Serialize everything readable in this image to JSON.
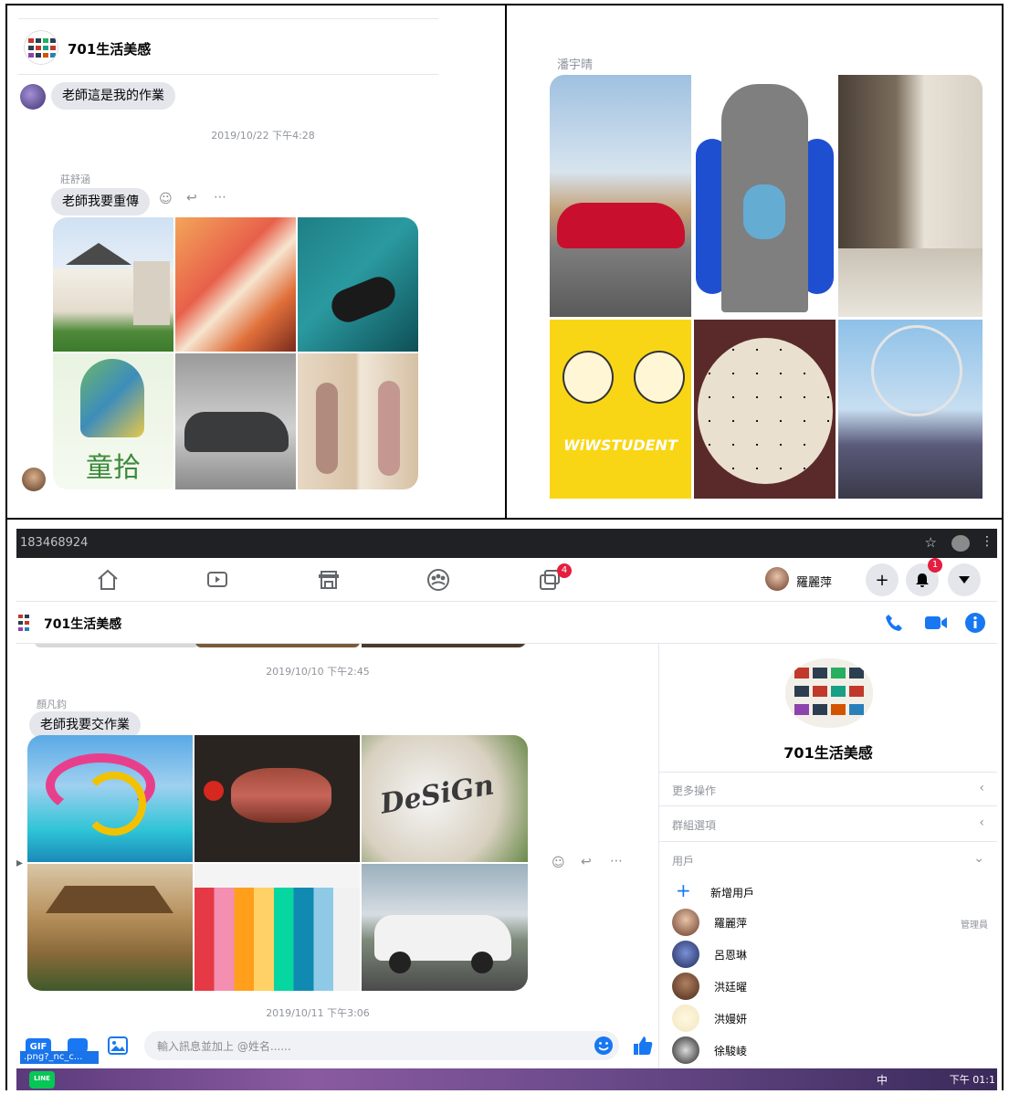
{
  "panel_top_left": {
    "group_title": "701生活美感",
    "message_1": "老師這是我的作業",
    "timestamp": "2019/10/22 下午4:28",
    "sender_name": "莊舒涵",
    "message_2": "老師我要重傳",
    "photo_labels": {
      "poster_text": "童拾"
    }
  },
  "panel_top_right": {
    "sender_name": "潘宇晴",
    "photo_labels": {
      "cartoon_text": "WiWSTUDENT"
    }
  },
  "browser": {
    "url_text": "183468924"
  },
  "facebook_nav": {
    "profile_name": "羅麗萍",
    "group_badge": "4",
    "notif_badge": "1"
  },
  "chat_header": {
    "title": "701生活美感"
  },
  "chat": {
    "timestamp_1": "2019/10/10 下午2:45",
    "sender_name": "顏凡鈞",
    "message": "老師我要交作業",
    "photo_labels": {
      "design_text": "DeSiGn"
    },
    "timestamp_2": "2019/10/11 下午3:06",
    "composer_placeholder": "輸入訊息並加上 @姓名......",
    "gif_label": "GIF",
    "file_chip": ".png?_nc_c..."
  },
  "sidebar": {
    "group_name": "701生活美感",
    "more_actions": "更多操作",
    "group_options": "群組選項",
    "users_label": "用戶",
    "add_user": "新增用戶",
    "members": [
      {
        "name": "羅麗萍",
        "role": "管理員"
      },
      {
        "name": "呂恩琳",
        "role": ""
      },
      {
        "name": "洪廷曜",
        "role": ""
      },
      {
        "name": "洪嫚妍",
        "role": ""
      },
      {
        "name": "徐駿崚",
        "role": ""
      }
    ]
  },
  "taskbar": {
    "line_label": "LINE",
    "clock": "下午 01:1",
    "ime_label": "中"
  },
  "colors": {
    "accent": "#1877f2",
    "badge": "#e41e3f",
    "bubble": "#e4e6eb"
  }
}
